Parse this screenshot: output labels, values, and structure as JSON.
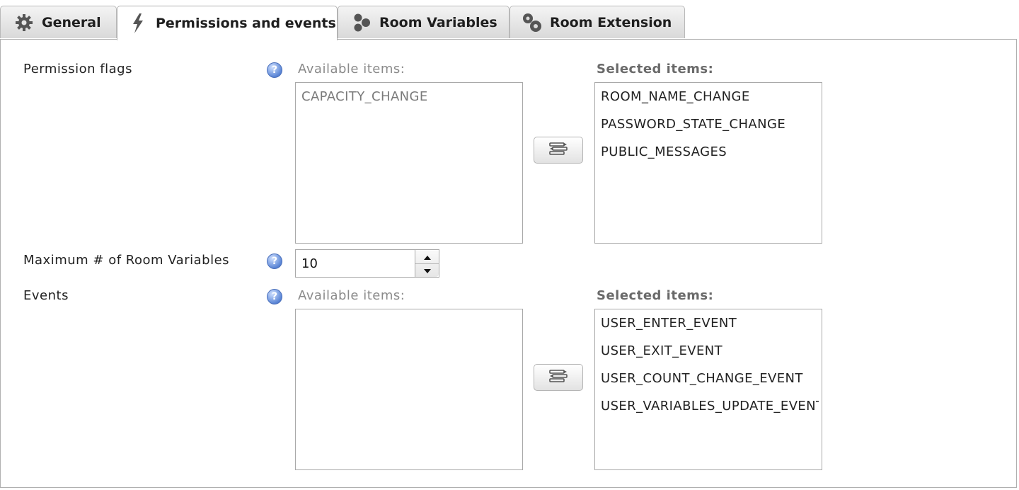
{
  "tabs": [
    {
      "label": "General",
      "icon": "gear-icon"
    },
    {
      "label": "Permissions and events",
      "icon": "lightning-icon"
    },
    {
      "label": "Room Variables",
      "icon": "variables-icon"
    },
    {
      "label": "Room Extension",
      "icon": "extension-icon"
    }
  ],
  "active_tab": "Permissions and events",
  "permission_flags": {
    "label": "Permission flags",
    "available_caption": "Available items:",
    "selected_caption": "Selected items:",
    "available_items": [
      "CAPACITY_CHANGE"
    ],
    "selected_items": [
      "ROOM_NAME_CHANGE",
      "PASSWORD_STATE_CHANGE",
      "PUBLIC_MESSAGES"
    ]
  },
  "max_room_variables": {
    "label": "Maximum # of Room Variables",
    "value": "10"
  },
  "events": {
    "label": "Events",
    "available_caption": "Available items:",
    "selected_caption": "Selected items:",
    "available_items": [],
    "selected_items": [
      "USER_ENTER_EVENT",
      "USER_EXIT_EVENT",
      "USER_COUNT_CHANGE_EVENT",
      "USER_VARIABLES_UPDATE_EVENT"
    ]
  },
  "colors": {
    "help_icon": "#5b86d6",
    "border": "#a9a9a9",
    "tab_bg": "#d9d9d9"
  }
}
